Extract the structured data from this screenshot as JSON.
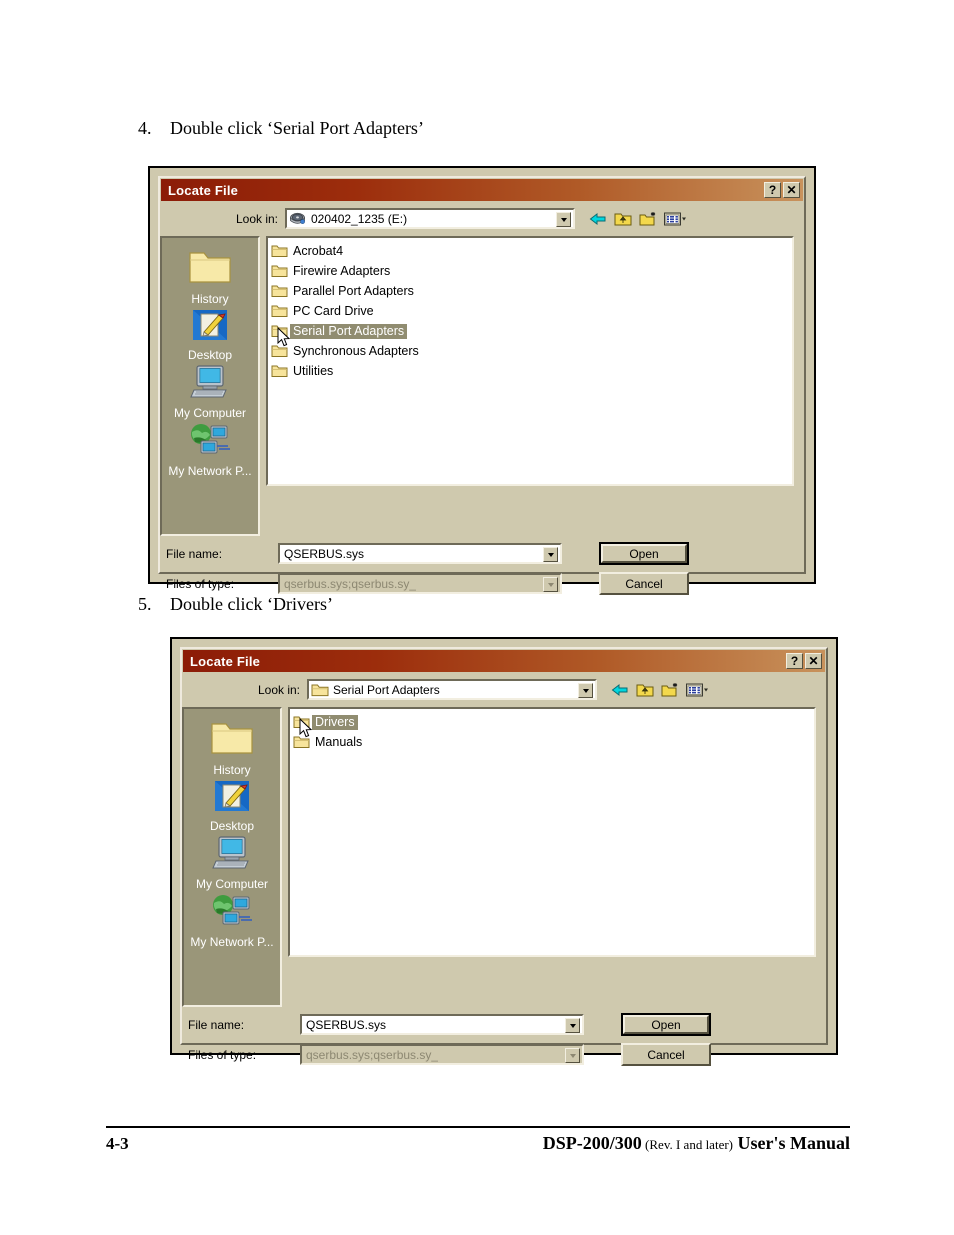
{
  "document": {
    "steps": [
      {
        "number": "4.",
        "text": "Double click ‘Serial Port Adapters’"
      },
      {
        "number": "5.",
        "text": "Double click ‘Drivers’"
      }
    ],
    "footer": {
      "page_number": "4-3",
      "model": "DSP-200/300",
      "revision": "(Rev. I and later)",
      "manual": "User's Manual"
    }
  },
  "colors": {
    "titlebar_start": "#8c1c07",
    "titlebar_end": "#c8925c",
    "dialog_face": "#cfc9ae",
    "places_panel": "#9a9679",
    "selection": "#908c70",
    "back_arrow": "#00d0d8",
    "folder_yellow": "#f5e49a"
  },
  "dialog1": {
    "title": "Locate File",
    "titlebar_buttons": [
      {
        "name": "help-button",
        "label": "?"
      },
      {
        "name": "close-button",
        "label": "✕"
      }
    ],
    "lookin": {
      "label": "Look in:",
      "value": "020402_1235 (E:)",
      "icon": "cdrom-drive-icon"
    },
    "toolbar": [
      {
        "name": "back-icon",
        "title": "Back"
      },
      {
        "name": "up-one-level-icon",
        "title": "Up One Level"
      },
      {
        "name": "new-folder-icon",
        "title": "Create New Folder"
      },
      {
        "name": "views-icon",
        "title": "Views"
      }
    ],
    "places": [
      {
        "label": "History",
        "icon": "history-folder-icon"
      },
      {
        "label": "Desktop",
        "icon": "desktop-icon"
      },
      {
        "label": "My Computer",
        "icon": "my-computer-icon"
      },
      {
        "label": "My Network P...",
        "icon": "my-network-places-icon"
      }
    ],
    "files": [
      {
        "label": "Acrobat4",
        "selected": false
      },
      {
        "label": "Firewire Adapters",
        "selected": false
      },
      {
        "label": "Parallel Port Adapters",
        "selected": false
      },
      {
        "label": "PC Card Drive",
        "selected": false
      },
      {
        "label": "Serial Port Adapters",
        "selected": true
      },
      {
        "label": "Synchronous Adapters",
        "selected": false
      },
      {
        "label": "Utilities",
        "selected": false
      }
    ],
    "filename": {
      "label": "File name:",
      "value": "QSERBUS.sys"
    },
    "filetype": {
      "label": "Files of type:",
      "value": "qserbus.sys;qserbus.sy_"
    },
    "buttons": {
      "open": "Open",
      "cancel": "Cancel"
    }
  },
  "dialog2": {
    "title": "Locate File",
    "titlebar_buttons": [
      {
        "name": "help-button",
        "label": "?"
      },
      {
        "name": "close-button",
        "label": "✕"
      }
    ],
    "lookin": {
      "label": "Look in:",
      "value": "Serial Port Adapters",
      "icon": "folder-icon"
    },
    "toolbar": [
      {
        "name": "back-icon",
        "title": "Back"
      },
      {
        "name": "up-one-level-icon",
        "title": "Up One Level"
      },
      {
        "name": "new-folder-icon",
        "title": "Create New Folder"
      },
      {
        "name": "views-icon",
        "title": "Views"
      }
    ],
    "places": [
      {
        "label": "History",
        "icon": "history-folder-icon"
      },
      {
        "label": "Desktop",
        "icon": "desktop-icon"
      },
      {
        "label": "My Computer",
        "icon": "my-computer-icon"
      },
      {
        "label": "My Network P...",
        "icon": "my-network-places-icon"
      }
    ],
    "files": [
      {
        "label": "Drivers",
        "selected": true
      },
      {
        "label": "Manuals",
        "selected": false
      }
    ],
    "filename": {
      "label": "File name:",
      "value": "QSERBUS.sys"
    },
    "filetype": {
      "label": "Files of type:",
      "value": "qserbus.sys;qserbus.sy_"
    },
    "buttons": {
      "open": "Open",
      "cancel": "Cancel"
    }
  }
}
